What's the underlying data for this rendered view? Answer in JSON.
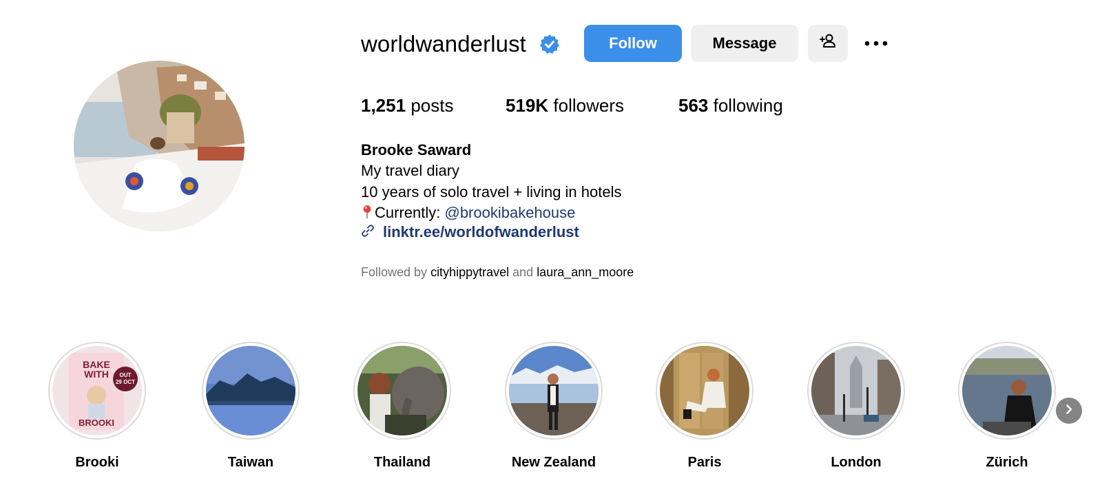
{
  "profile": {
    "username": "worldwanderlust",
    "verified": true,
    "follow_label": "Follow",
    "message_label": "Message",
    "accent": "#3b8fe8"
  },
  "stats": {
    "posts_count": "1,251",
    "posts_label": "posts",
    "followers_count": "519K",
    "followers_label": "followers",
    "following_count": "563",
    "following_label": "following"
  },
  "bio": {
    "name": "Brooke Saward",
    "line1": "My travel diary",
    "line2": "10 years of solo travel + living in hotels",
    "line3_prefix": "Currently: ",
    "line3_mention": "@brookibakehouse",
    "link": "linktr.ee/worldofwanderlust",
    "followed_by_prefix": "Followed by",
    "followed_by_user1": "cityhippytravel",
    "followed_by_and": "and",
    "followed_by_user2": "laura_ann_moore"
  },
  "highlights": [
    {
      "label": "Brooki",
      "book_title1": "BAKE",
      "book_title2": "WITH",
      "book_title3": "BROOKI",
      "badge1": "OUT",
      "badge2": "29 OCT"
    },
    {
      "label": "Taiwan"
    },
    {
      "label": "Thailand"
    },
    {
      "label": "New Zealand"
    },
    {
      "label": "Paris"
    },
    {
      "label": "London"
    },
    {
      "label": "Zürich"
    }
  ],
  "icons": {
    "verified": "verified-badge-icon",
    "add_user": "add-user-icon",
    "more": "more-options-icon",
    "pin": "pin-icon",
    "link": "link-icon",
    "next": "chevron-right-icon"
  }
}
